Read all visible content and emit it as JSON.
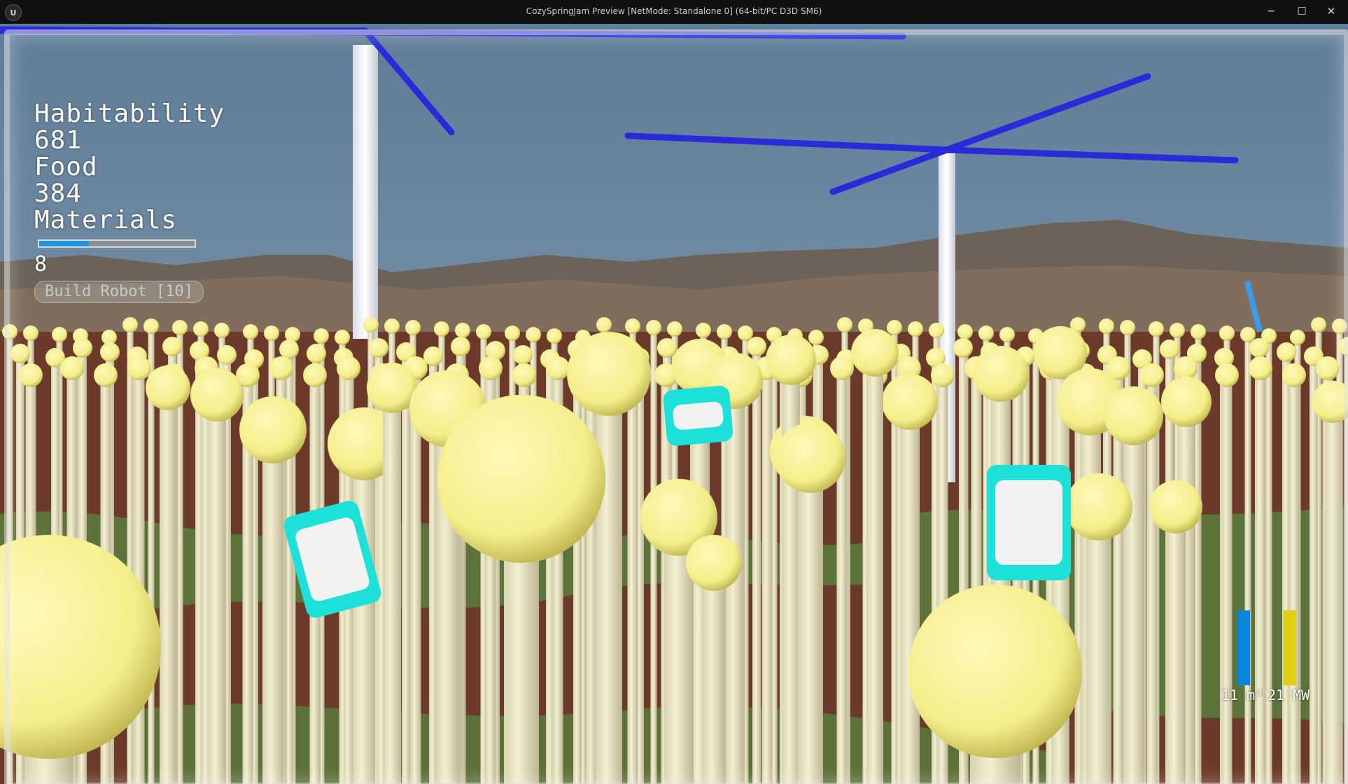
{
  "window": {
    "title": "CozySpringJam Preview [NetMode: Standalone 0]  (64-bit/PC D3D SM6)",
    "logo_glyph": "U",
    "minimize_glyph": "─",
    "maximize_glyph": "☐",
    "close_glyph": "✕"
  },
  "hud": {
    "habitability_label": "Habitability",
    "habitability_value": "681",
    "food_label": "Food",
    "food_value": "384",
    "materials_label": "Materials",
    "materials_progress": 0.32,
    "materials_value": "8",
    "build_button_label": "Build Robot [10]"
  },
  "meters": {
    "water_label": "11 m³",
    "water_fill": 1.0,
    "water_color": "#0a86e0",
    "power_label": "21 MW",
    "power_fill": 1.0,
    "power_color": "#e0cf10"
  },
  "colors": {
    "sky_top": "#5f7d99",
    "sky_bottom": "#8fa2b4",
    "plant_head": "#f4ee8a",
    "plant_stem": "#f3efd2",
    "turbine_blade": "#2a2ad8",
    "ground": "#6b3a2a",
    "grass": "#5b7a3b",
    "robot_accent": "#1de0d8"
  }
}
